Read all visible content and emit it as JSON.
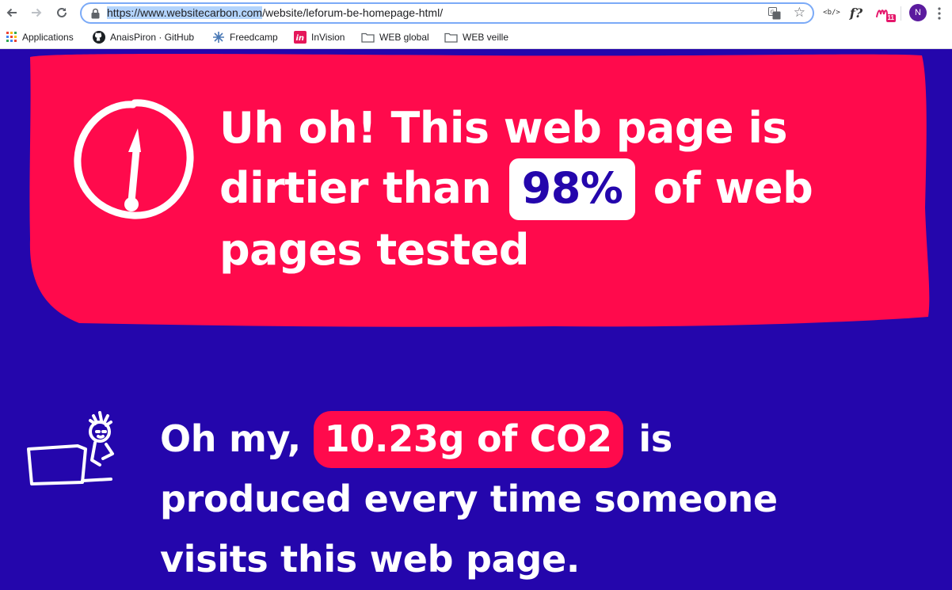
{
  "browser": {
    "url_host": "https://www.websitecarbon.com",
    "url_path": "/website/leforum-be-homepage-html/",
    "profile_initial": "N",
    "extension_code_label": "<b/>",
    "extension_f_label": "f?",
    "extension_badge_count": "11"
  },
  "bookmarks": [
    {
      "label": "Applications",
      "icon": "apps-grid-icon"
    },
    {
      "label": "AnaisPiron · GitHub",
      "icon": "github-icon"
    },
    {
      "label": "Freedcamp",
      "icon": "freedcamp-icon"
    },
    {
      "label": "InVision",
      "icon": "invision-icon"
    },
    {
      "label": "WEB global",
      "icon": "folder-icon"
    },
    {
      "label": "WEB veille",
      "icon": "folder-icon"
    }
  ],
  "result": {
    "headline_pre": "Uh oh! This web page is dirtier than",
    "percent": "98%",
    "headline_post": "of web pages tested"
  },
  "co2": {
    "prefix": "Oh my,",
    "amount": "10.23g of CO2",
    "suffix": "is produced every time someone visits this web page."
  },
  "colors": {
    "page_background": "#2406ac",
    "alert_red": "#ff0a4c",
    "badge_white": "#ffffff"
  }
}
